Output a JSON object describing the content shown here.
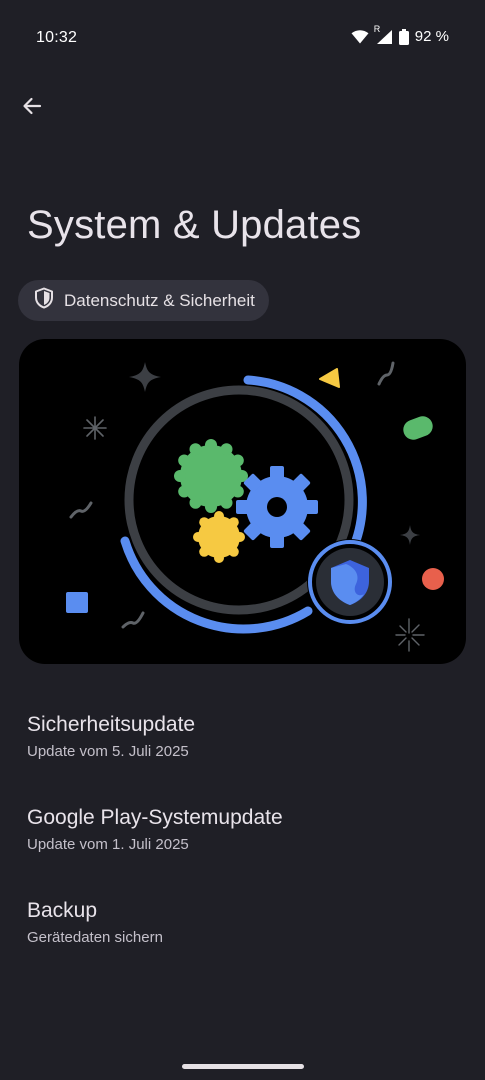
{
  "status_bar": {
    "time": "10:32",
    "wifi_icon": "wifi-icon",
    "signal_icon": "signal-roaming-icon",
    "roaming_mark": "R",
    "battery_icon": "battery-icon",
    "battery_text": "92 %",
    "battery_level": 0.92
  },
  "header": {
    "back_icon": "arrow-back-icon",
    "title": "System & Updates"
  },
  "chip": {
    "icon": "shield-icon",
    "label": "Datenschutz & Sicherheit"
  },
  "illustration": {
    "description_icons": [
      "gear-icon",
      "shield-icon",
      "sparkle-icon"
    ],
    "colors": {
      "blue": "#5a8df0",
      "green": "#5ab96c",
      "yellow": "#f6c942",
      "red": "#e8604c",
      "ring": "#3c3f44"
    }
  },
  "list": {
    "items": [
      {
        "title": "Sicherheitsupdate",
        "subtitle": "Update vom 5. Juli 2025"
      },
      {
        "title": "Google Play-Systemupdate",
        "subtitle": "Update vom 1. Juli 2025"
      },
      {
        "title": "Backup",
        "subtitle": "Gerätedaten sichern"
      }
    ]
  },
  "colors": {
    "background": "#1f1f26",
    "chip_bg": "#33333d",
    "text_primary": "#e8e3ea",
    "text_secondary": "#c4c0ca"
  }
}
